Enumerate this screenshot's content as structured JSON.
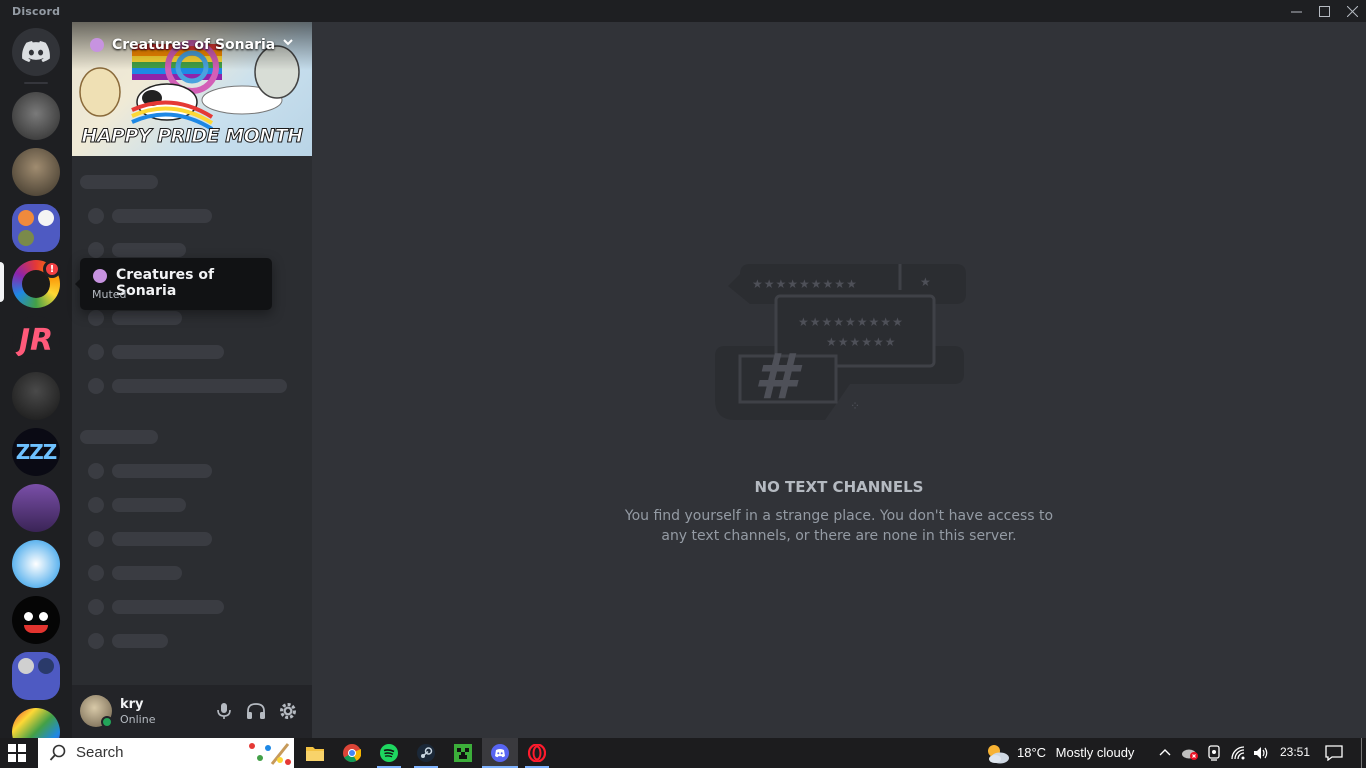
{
  "window": {
    "title": "Discord",
    "minimize_glyph": "—",
    "maximize_glyph": "☐",
    "close_glyph": "✕"
  },
  "server_rail": {
    "home_icon": "discord-logo-icon",
    "active_server_alert": "!"
  },
  "server": {
    "name": "Creatures of Sonaria",
    "banner_text": "HAPPY PRIDE MONTH",
    "menu_icon": "chevron-down-icon"
  },
  "tooltip": {
    "title": "Creatures of Sonaria",
    "subtitle": "Muted"
  },
  "user": {
    "name": "kry",
    "status": "Online",
    "status_color": "#23a559"
  },
  "empty_state": {
    "title": "NO TEXT CHANNELS",
    "description": "You find yourself in a strange place. You don't have access to any text channels, or there are none in this server."
  },
  "taskbar": {
    "search_placeholder": "Search",
    "weather_temp": "18°C",
    "weather_desc": "Mostly cloudy",
    "time": "23:51"
  },
  "colors": {
    "rail_bg": "#1e1f22",
    "sidebar_bg": "#2b2d31",
    "main_bg": "#313338",
    "accent": "#5865f2",
    "alert": "#f23f43"
  }
}
